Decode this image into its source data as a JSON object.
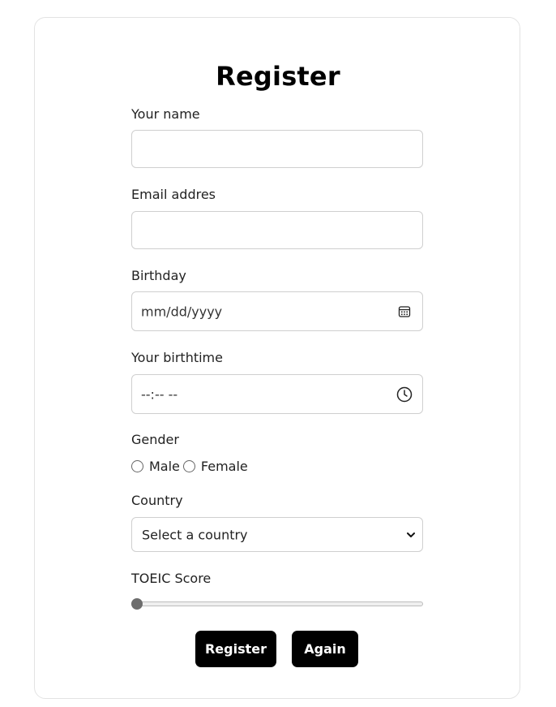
{
  "form": {
    "title": "Register",
    "name": {
      "label": "Your name",
      "value": ""
    },
    "email": {
      "label": "Email addres",
      "value": ""
    },
    "birthday": {
      "label": "Birthday",
      "placeholder": "mm/dd/yyyy",
      "icon": "calendar-icon"
    },
    "birthtime": {
      "label": "Your birthtime",
      "placeholder": "--:-- --",
      "icon": "clock-icon"
    },
    "gender": {
      "label": "Gender",
      "options": [
        {
          "label": "Male",
          "selected": false
        },
        {
          "label": "Female",
          "selected": false
        }
      ]
    },
    "country": {
      "label": "Country",
      "selected": "Select a country"
    },
    "toeic": {
      "label": "TOEIC Score",
      "value_fraction": 0
    },
    "buttons": {
      "register": "Register",
      "again": "Again"
    }
  },
  "colors": {
    "button_bg": "#000000",
    "button_text": "#ffffff",
    "border": "#cfcfcf",
    "slider_thumb": "#6d6d6d"
  }
}
